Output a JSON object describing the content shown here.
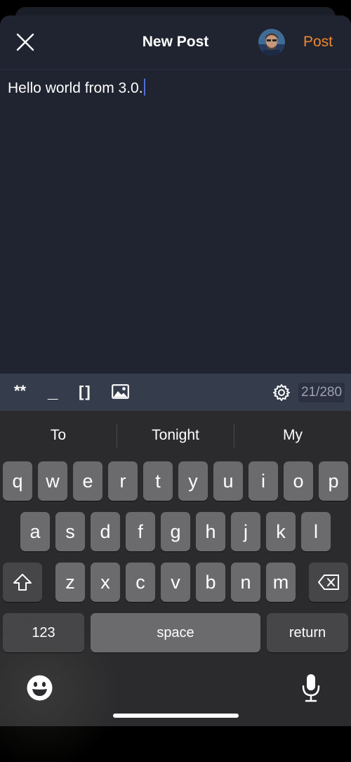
{
  "header": {
    "title": "New Post",
    "post_label": "Post",
    "close_icon": "close-icon",
    "accent_color": "#f0872f"
  },
  "composer": {
    "text": "Hello world from 3.0."
  },
  "toolbar": {
    "bold_label": "**",
    "italic_label": "_",
    "link_label": "[]",
    "image_icon": "image-icon",
    "settings_icon": "gear-icon",
    "char_count": "21/280"
  },
  "keyboard": {
    "suggestions": [
      "To",
      "Tonight",
      "My"
    ],
    "row1": [
      "q",
      "w",
      "e",
      "r",
      "t",
      "y",
      "u",
      "i",
      "o",
      "p"
    ],
    "row2": [
      "a",
      "s",
      "d",
      "f",
      "g",
      "h",
      "j",
      "k",
      "l"
    ],
    "row3": [
      "z",
      "x",
      "c",
      "v",
      "b",
      "n",
      "m"
    ],
    "numbers_label": "123",
    "space_label": "space",
    "return_label": "return",
    "shift_icon": "shift-icon",
    "backspace_icon": "backspace-icon",
    "emoji_icon": "emoji-icon",
    "mic_icon": "microphone-icon"
  }
}
